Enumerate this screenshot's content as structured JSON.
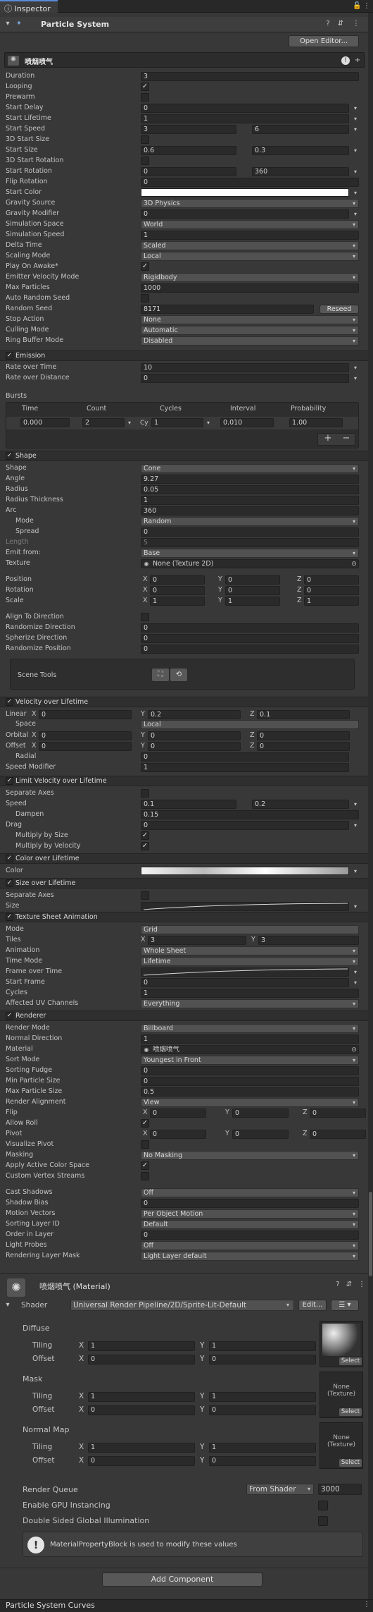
{
  "tab": {
    "title": "Inspector"
  },
  "component": {
    "title": "Particle System",
    "open_editor": "Open Editor..."
  },
  "system_name": "喷烟喷气",
  "main": [
    {
      "label": "Duration",
      "kind": "field",
      "value": "3"
    },
    {
      "label": "Looping",
      "kind": "check",
      "value": "✓"
    },
    {
      "label": "Prewarm",
      "kind": "check",
      "value": ""
    },
    {
      "label": "Start Delay",
      "kind": "fieldd",
      "value": "0"
    },
    {
      "label": "Start Lifetime",
      "kind": "fieldd",
      "value": "1"
    },
    {
      "label": "Start Speed",
      "kind": "range",
      "value": "3",
      "value2": "6"
    },
    {
      "label": "3D Start Size",
      "kind": "check",
      "value": ""
    },
    {
      "label": "Start Size",
      "kind": "range",
      "value": "0.6",
      "value2": "0.3"
    },
    {
      "label": "3D Start Rotation",
      "kind": "check",
      "value": ""
    },
    {
      "label": "Start Rotation",
      "kind": "range",
      "value": "0",
      "value2": "360"
    },
    {
      "label": "Flip Rotation",
      "kind": "field",
      "value": "0"
    },
    {
      "label": "Start Color",
      "kind": "color",
      "value": ""
    },
    {
      "label": "Gravity Source",
      "kind": "dropdown",
      "value": "3D Physics"
    },
    {
      "label": "Gravity Modifier",
      "kind": "fieldd",
      "value": "0"
    },
    {
      "label": "Simulation Space",
      "kind": "dropdown",
      "value": "World"
    },
    {
      "label": "Simulation Speed",
      "kind": "field",
      "value": "1"
    },
    {
      "label": "Delta Time",
      "kind": "dropdown",
      "value": "Scaled"
    },
    {
      "label": "Scaling Mode",
      "kind": "dropdown",
      "value": "Local"
    },
    {
      "label": "Play On Awake*",
      "kind": "check",
      "value": "✓"
    },
    {
      "label": "Emitter Velocity Mode",
      "kind": "dropdown",
      "value": "Rigidbody"
    },
    {
      "label": "Max Particles",
      "kind": "field",
      "value": "1000"
    },
    {
      "label": "Auto Random Seed",
      "kind": "check",
      "value": ""
    },
    {
      "label": "Random Seed",
      "kind": "seed",
      "value": "8171",
      "button": "Reseed"
    },
    {
      "label": "Stop Action",
      "kind": "dropdown",
      "value": "None"
    },
    {
      "label": "Culling Mode",
      "kind": "dropdown",
      "value": "Automatic"
    },
    {
      "label": "Ring Buffer Mode",
      "kind": "dropdown",
      "value": "Disabled"
    }
  ],
  "emission": {
    "title": "Emission",
    "rows": [
      {
        "label": "Rate over Time",
        "kind": "fieldd",
        "value": "10"
      },
      {
        "label": "Rate over Distance",
        "kind": "fieldd",
        "value": "0"
      }
    ],
    "bursts_label": "Bursts",
    "headers": [
      "Time",
      "Count",
      "Cycles",
      "Interval",
      "Probability"
    ],
    "burst": {
      "time": "0.000",
      "count": "2",
      "cy": "Cy",
      "cycles": "1",
      "interval": "0.010",
      "probability": "1.00"
    },
    "add": "+",
    "remove": "−"
  },
  "shape": {
    "title": "Shape",
    "rows": [
      {
        "label": "Shape",
        "kind": "dropdown",
        "value": "Cone"
      },
      {
        "label": "Angle",
        "kind": "field",
        "value": "9.27"
      },
      {
        "label": "Radius",
        "kind": "field",
        "value": "0.05"
      },
      {
        "label": "Radius Thickness",
        "kind": "field",
        "value": "1"
      },
      {
        "label": "Arc",
        "kind": "field",
        "value": "360"
      },
      {
        "label": "Mode",
        "kind": "dropdown",
        "value": "Random",
        "indent": true
      },
      {
        "label": "Spread",
        "kind": "field",
        "value": "0",
        "indent": true
      },
      {
        "label": "Length",
        "kind": "field",
        "value": "5",
        "muted": true
      },
      {
        "label": "Emit from:",
        "kind": "dropdown",
        "value": "Base"
      },
      {
        "label": "Texture",
        "kind": "object",
        "value": "None (Texture 2D)"
      }
    ],
    "position": {
      "label": "Position",
      "x": "0",
      "y": "0",
      "z": "0"
    },
    "rotation": {
      "label": "Rotation",
      "x": "0",
      "y": "0",
      "z": "0"
    },
    "scale": {
      "label": "Scale",
      "x": "1",
      "y": "1",
      "z": "1"
    },
    "rows2": [
      {
        "label": "Align To Direction",
        "kind": "check",
        "value": ""
      },
      {
        "label": "Randomize Direction",
        "kind": "field",
        "value": "0"
      },
      {
        "label": "Spherize Direction",
        "kind": "field",
        "value": "0"
      },
      {
        "label": "Randomize Position",
        "kind": "field",
        "value": "0"
      }
    ],
    "scene_tools": "Scene Tools"
  },
  "velocity": {
    "title": "Velocity over Lifetime",
    "linear": {
      "label": "Linear",
      "x": "0",
      "y": "0.2",
      "z": "0.1"
    },
    "space": {
      "label": "Space",
      "value": "Local"
    },
    "orbital": {
      "label": "Orbital",
      "x": "0",
      "y": "0",
      "z": "0"
    },
    "offset": {
      "label": "Offset",
      "x": "0",
      "y": "0",
      "z": "0"
    },
    "radial": {
      "label": "Radial",
      "value": "0"
    },
    "speed_mod": {
      "label": "Speed Modifier",
      "value": "1"
    }
  },
  "limit": {
    "title": "Limit Velocity over Lifetime",
    "rows": [
      {
        "label": "Separate Axes",
        "kind": "check",
        "value": ""
      },
      {
        "label": "Speed",
        "kind": "range",
        "value": "0.1",
        "value2": "0.2"
      },
      {
        "label": "Dampen",
        "kind": "field",
        "value": "0.15",
        "indent": true
      },
      {
        "label": "Drag",
        "kind": "fieldd",
        "value": "0"
      },
      {
        "label": "Multiply by Size",
        "kind": "check",
        "value": "✓",
        "indent": true
      },
      {
        "label": "Multiply by Velocity",
        "kind": "check",
        "value": "✓",
        "indent": true
      }
    ]
  },
  "color_lt": {
    "title": "Color over Lifetime",
    "label": "Color"
  },
  "size_lt": {
    "title": "Size over Lifetime",
    "sep": "Separate Axes",
    "size": "Size"
  },
  "tsa": {
    "title": "Texture Sheet Animation",
    "mode": {
      "label": "Mode",
      "value": "Grid"
    },
    "tiles": {
      "label": "Tiles",
      "x": "3",
      "y": "3"
    },
    "rows": [
      {
        "label": "Animation",
        "kind": "dropdown",
        "value": "Whole Sheet"
      },
      {
        "label": "Time Mode",
        "kind": "dropdown",
        "value": "Lifetime"
      },
      {
        "label": "Frame over Time",
        "kind": "curve",
        "value": ""
      },
      {
        "label": "Start Frame",
        "kind": "fieldd",
        "value": "0"
      },
      {
        "label": "Cycles",
        "kind": "field",
        "value": "1"
      },
      {
        "label": "Affected UV Channels",
        "kind": "dropdown",
        "value": "Everything"
      }
    ]
  },
  "renderer": {
    "title": "Renderer",
    "rows": [
      {
        "label": "Render Mode",
        "kind": "dropdown",
        "value": "Billboard"
      },
      {
        "label": "Normal Direction",
        "kind": "field",
        "value": "1"
      },
      {
        "label": "Material",
        "kind": "object",
        "value": "喷烟喷气"
      },
      {
        "label": "Sort Mode",
        "kind": "dropdown",
        "value": "Youngest in Front"
      },
      {
        "label": "Sorting Fudge",
        "kind": "field",
        "value": "0"
      },
      {
        "label": "Min Particle Size",
        "kind": "field",
        "value": "0"
      },
      {
        "label": "Max Particle Size",
        "kind": "field",
        "value": "0.5"
      },
      {
        "label": "Render Alignment",
        "kind": "dropdown",
        "value": "View"
      }
    ],
    "flip": {
      "label": "Flip",
      "x": "0",
      "y": "0",
      "z": "0"
    },
    "allow_roll": {
      "label": "Allow Roll",
      "value": "✓"
    },
    "pivot": {
      "label": "Pivot",
      "x": "0",
      "y": "0",
      "z": "0"
    },
    "rows2": [
      {
        "label": "Visualize Pivot",
        "kind": "check",
        "value": ""
      },
      {
        "label": "Masking",
        "kind": "dropdown",
        "value": "No Masking"
      },
      {
        "label": "Apply Active Color Space",
        "kind": "check",
        "value": "✓"
      },
      {
        "label": "Custom Vertex Streams",
        "kind": "check",
        "value": ""
      }
    ],
    "rows3": [
      {
        "label": "Cast Shadows",
        "kind": "dropdown",
        "value": "Off"
      },
      {
        "label": "Shadow Bias",
        "kind": "field",
        "value": "0"
      },
      {
        "label": "Motion Vectors",
        "kind": "dropdown",
        "value": "Per Object Motion"
      },
      {
        "label": "Sorting Layer ID",
        "kind": "dropdown",
        "value": "Default"
      },
      {
        "label": "Order in Layer",
        "kind": "field",
        "value": "0"
      },
      {
        "label": "Light Probes",
        "kind": "dropdown",
        "value": "Off"
      },
      {
        "label": "Rendering Layer Mask",
        "kind": "dropdown",
        "value": "Light Layer default"
      }
    ]
  },
  "material": {
    "title": "喷烟喷气 (Material)",
    "shader_label": "Shader",
    "shader": "Universal Render Pipeline/2D/Sprite-Lit-Default",
    "edit": "Edit...",
    "diffuse": "Diffuse",
    "mask": "Mask",
    "normal": "Normal Map",
    "tiling": "Tiling",
    "offset": "Offset",
    "tile_x": "1",
    "tile_y": "1",
    "off_x": "0",
    "off_y": "0",
    "select": "Select",
    "none_texture": "None\n(Texture)",
    "render_queue": "Render Queue",
    "from_shader": "From Shader",
    "queue_value": "3000",
    "gpu": "Enable GPU Instancing",
    "dsgi": "Double Sided Global Illumination",
    "info": "MaterialPropertyBlock is used to modify these values"
  },
  "add_component": "Add Component",
  "curves_title": "Particle System Curves"
}
